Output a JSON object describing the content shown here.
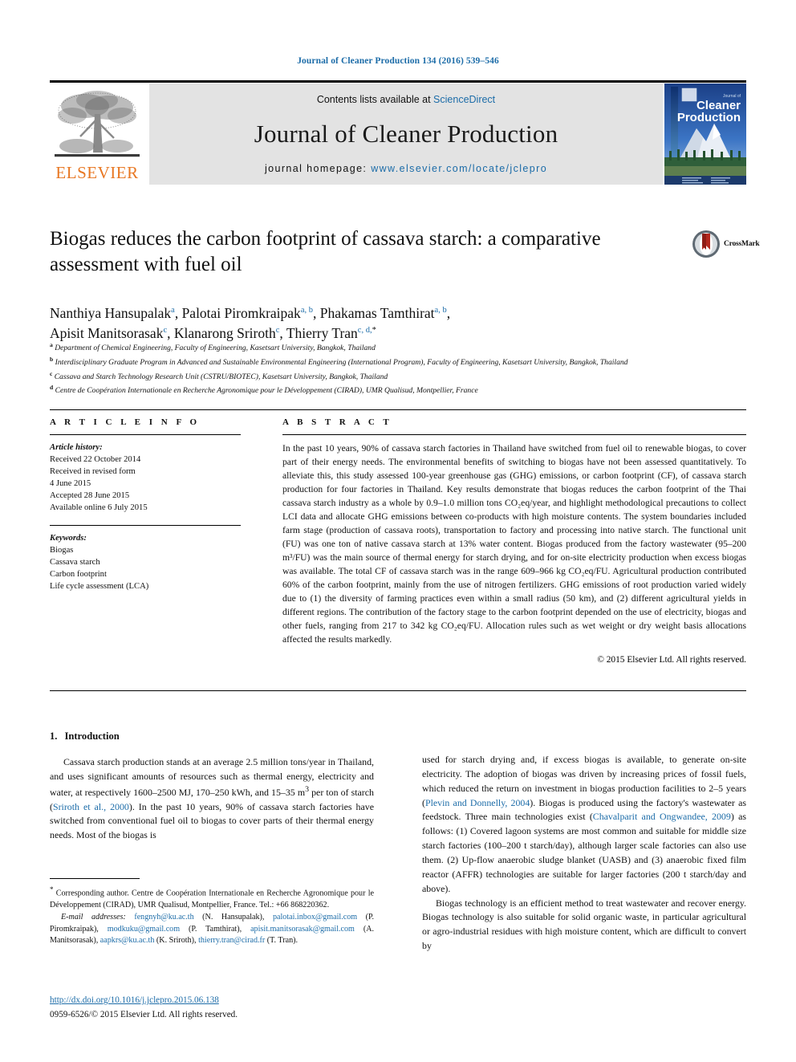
{
  "running_head": "Journal of Cleaner Production 134 (2016) 539–546",
  "masthead": {
    "contents_prefix": "Contents lists available at ",
    "sciencedirect": "ScienceDirect",
    "journal_title": "Journal of Cleaner Production",
    "homepage_prefix": "journal homepage: ",
    "homepage_url": "www.elsevier.com/locate/jclepro",
    "publisher": "ELSEVIER",
    "cover_line1": "Journal of",
    "cover_line2": "Cleaner",
    "cover_line3": "Production"
  },
  "article": {
    "title": "Biogas reduces the carbon footprint of cassava starch: a comparative assessment with fuel oil",
    "crossmark_label": "CrossMark",
    "authors_line1_a": "Nanthiya Hansupalak",
    "authors_line1_a_sup": "a",
    "authors_line1_b": "Palotai Piromkraipak",
    "authors_line1_b_sup": "a, b",
    "authors_line1_c": "Phakamas Tamthirat",
    "authors_line1_c_sup": "a, b",
    "authors_line2_a": "Apisit Manitsorasak",
    "authors_line2_a_sup": "c",
    "authors_line2_b": "Klanarong Sriroth",
    "authors_line2_b_sup": "c",
    "authors_line2_c": "Thierry Tran",
    "authors_line2_c_sup": "c, d,",
    "affiliations": [
      {
        "mark": "a",
        "text": "Department of Chemical Engineering, Faculty of Engineering, Kasetsart University, Bangkok, Thailand"
      },
      {
        "mark": "b",
        "text": "Interdisciplinary Graduate Program in Advanced and Sustainable Environmental Engineering (International Program), Faculty of Engineering, Kasetsart University, Bangkok, Thailand"
      },
      {
        "mark": "c",
        "text": "Cassava and Starch Technology Research Unit (CSTRU/BIOTEC), Kasetsart University, Bangkok, Thailand"
      },
      {
        "mark": "d",
        "text": "Centre de Coopération Internationale en Recherche Agronomique pour le Développement (CIRAD), UMR Qualisud, Montpellier, France"
      }
    ]
  },
  "article_info": {
    "heading": "A R T I C L E   I N F O",
    "history_label": "Article history:",
    "history": [
      "Received 22 October 2014",
      "Received in revised form",
      "4 June 2015",
      "Accepted 28 June 2015",
      "Available online 6 July 2015"
    ],
    "keywords_label": "Keywords:",
    "keywords": [
      "Biogas",
      "Cassava starch",
      "Carbon footprint",
      "Life cycle assessment (LCA)"
    ]
  },
  "abstract": {
    "heading": "A B S T R A C T",
    "text": "In the past 10 years, 90% of cassava starch factories in Thailand have switched from fuel oil to renewable biogas, to cover part of their energy needs. The environmental benefits of switching to biogas have not been assessed quantitatively. To alleviate this, this study assessed 100-year greenhouse gas (GHG) emissions, or carbon footprint (CF), of cassava starch production for four factories in Thailand. Key results demonstrate that biogas reduces the carbon footprint of the Thai cassava starch industry as a whole by 0.9–1.0 million tons CO₂eq/year, and highlight methodological precautions to collect LCI data and allocate GHG emissions between co-products with high moisture contents. The system boundaries included farm stage (production of cassava roots), transportation to factory and processing into native starch. The functional unit (FU) was one ton of native cassava starch at 13% water content. Biogas produced from the factory wastewater (95–200 m³/FU) was the main source of thermal energy for starch drying, and for on-site electricity production when excess biogas was available. The total CF of cassava starch was in the range 609–966 kg CO₂eq/FU. Agricultural production contributed 60% of the carbon footprint, mainly from the use of nitrogen fertilizers. GHG emissions of root production varied widely due to (1) the diversity of farming practices even within a small radius (50 km), and (2) different agricultural yields in different regions. The contribution of the factory stage to the carbon footprint depended on the use of electricity, biogas and other fuels, ranging from 217 to 342 kg CO₂eq/FU. Allocation rules such as wet weight or dry weight basis allocations affected the results markedly.",
    "copyright": "© 2015 Elsevier Ltd. All rights reserved."
  },
  "introduction": {
    "number": "1.",
    "heading": "Introduction",
    "left_p1_part1": "Cassava starch production stands at an average 2.5 million tons/year in Thailand, and uses significant amounts of resources such as thermal energy, electricity and water, at respectively 1600–2500 MJ, 170–250 kWh, and 15–35 m",
    "left_p1_sup": "3",
    "left_p1_part2": " per ton of starch (",
    "left_cite1": "Sriroth et al., 2000",
    "left_p1_part3": "). In the past 10 years, 90% of cassava starch factories have switched from conventional fuel oil to biogas to cover parts of their thermal energy needs. Most of the biogas is",
    "right_p1_part1": "used for starch drying and, if excess biogas is available, to generate on-site electricity. The adoption of biogas was driven by increasing prices of fossil fuels, which reduced the return on investment in biogas production facilities to 2–5 years (",
    "right_cite1": "Plevin and Donnelly, 2004",
    "right_p1_part2": "). Biogas is produced using the factory's wastewater as feedstock. Three main technologies exist (",
    "right_cite2": "Chavalparit and Ongwandee, 2009",
    "right_p1_part3": ") as follows: (1) Covered lagoon systems are most common and suitable for middle size starch factories (100–200 t starch/day), although larger scale factories can also use them. (2) Up-flow anaerobic sludge blanket (UASB) and (3) anaerobic fixed film reactor (AFFR) technologies are suitable for larger factories (200 t starch/day and above).",
    "right_p2": "Biogas technology is an efficient method to treat wastewater and recover energy. Biogas technology is also suitable for solid organic waste, in particular agricultural or agro-industrial residues with high moisture content, which are difficult to convert by"
  },
  "footnote": {
    "star": "*",
    "corresponding": " Corresponding author. Centre de Coopération Internationale en Recherche Agronomique pour le Développement (CIRAD), UMR Qualisud, Montpellier, France. Tel.: +66 868220362.",
    "email_label": "E-mail addresses:",
    "emails": [
      {
        "addr": "fengnyh@ku.ac.th",
        "who": " (N. Hansupalak), "
      },
      {
        "addr": "palotai.inbox@gmail.com",
        "who": " (P. Piromkraipak), "
      },
      {
        "addr": "modkuku@gmail.com",
        "who": " (P. Tamthirat), "
      },
      {
        "addr": "apisit.manitsorasak@gmail.com",
        "who": " (A. Manitsorasak), "
      },
      {
        "addr": "aapkrs@ku.ac.th",
        "who": " (K. Sriroth), "
      },
      {
        "addr": "thierry.tran@cirad.fr",
        "who": " (T. Tran)."
      }
    ]
  },
  "imprint": {
    "doi": "http://dx.doi.org/10.1016/j.jclepro.2015.06.138",
    "issn_line": "0959-6526/© 2015 Elsevier Ltd. All rights reserved."
  },
  "colors": {
    "link_blue": "#1c6ca8",
    "elsevier_orange": "#E87722",
    "band_gray": "#e3e3e3"
  }
}
